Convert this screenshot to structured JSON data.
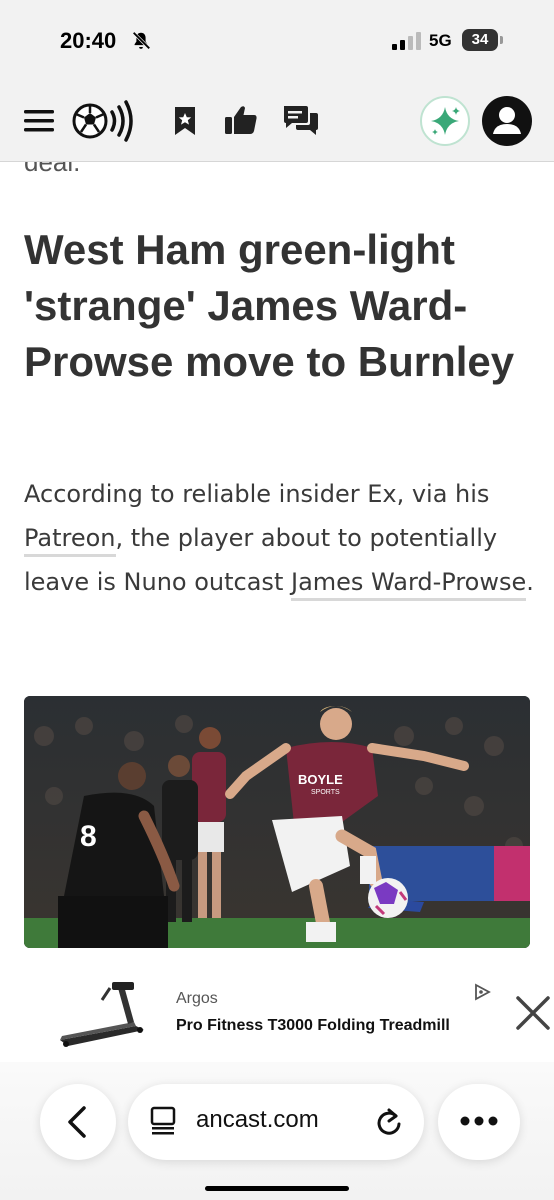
{
  "status_bar": {
    "time": "20:40",
    "network": "5G",
    "battery": "34"
  },
  "article": {
    "clipped_line": "deal.",
    "headline": "West Ham green-light 'strange' James Ward-Prowse move to Burnley",
    "lede": {
      "part1": "According to reliable insider Ex, via his ",
      "link1": "Patreon",
      "part2": ", the player about to potentially leave is Nuno outcast ",
      "link2": "James Ward-Prowse",
      "part3": "."
    },
    "photo": {
      "sponsor_text": "BOYLE",
      "sponsor_sub": "SPORTS",
      "player_number": "8"
    }
  },
  "ad": {
    "brand": "Argos",
    "title": "Pro Fitness T3000 Folding Treadmill"
  },
  "browser": {
    "url": "ancast.com"
  },
  "colors": {
    "header_bg": "#f2f2f2",
    "sparkle": "#3aa878",
    "claret": "#7a263a",
    "text": "#333333"
  },
  "icons": [
    "bell-off-icon",
    "signal-icon",
    "menu-icon",
    "podcast-logo-icon",
    "bookmark-icon",
    "thumbs-up-icon",
    "comments-icon",
    "sparkle-icon",
    "user-icon",
    "ad-choices-icon",
    "close-icon",
    "back-icon",
    "reader-mode-icon",
    "reload-icon",
    "more-icon"
  ]
}
